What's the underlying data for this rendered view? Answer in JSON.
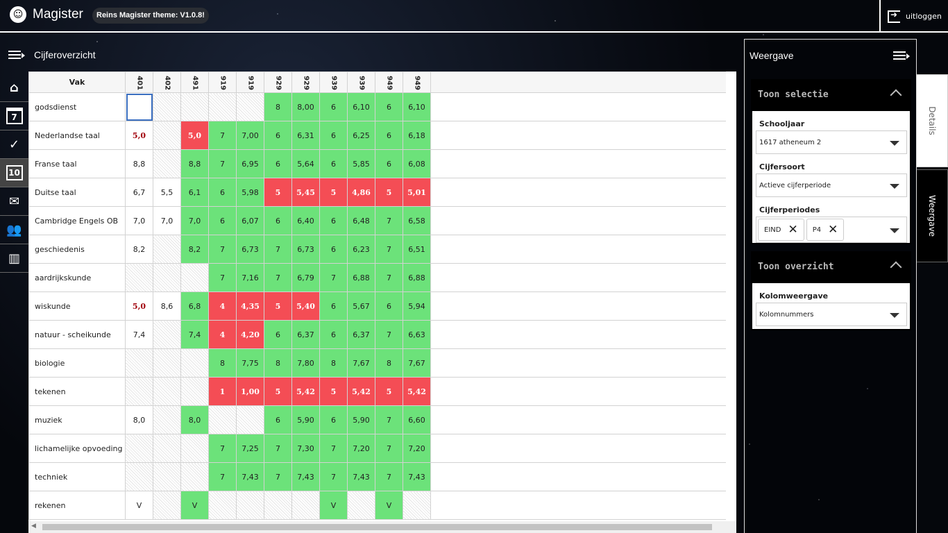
{
  "app": {
    "brand": "Magister",
    "logo_glyph": "☺",
    "theme_badge": "Reins Magister theme: V1.0.8!",
    "logout_label": "uitloggen"
  },
  "page": {
    "title": "Cijferoverzicht"
  },
  "nav": [
    {
      "name": "home-icon",
      "glyph": "⌂"
    },
    {
      "name": "calendar-icon",
      "glyph": "7"
    },
    {
      "name": "check-icon",
      "glyph": "✓"
    },
    {
      "name": "grades-icon",
      "glyph": "10",
      "active": true
    },
    {
      "name": "mail-icon",
      "glyph": "✉"
    },
    {
      "name": "people-icon",
      "glyph": "👥"
    },
    {
      "name": "books-icon",
      "glyph": "▥"
    }
  ],
  "table": {
    "vak_header": "Vak",
    "columns": [
      "401",
      "402",
      "491",
      "919",
      "919",
      "929",
      "929",
      "939",
      "939",
      "949",
      "949"
    ],
    "rows": [
      {
        "subject": "godsdienst",
        "cells": [
          {
            "v": "",
            "c": "sel"
          },
          {
            "v": "",
            "c": "hatch"
          },
          {
            "v": "",
            "c": "hatch"
          },
          {
            "v": "",
            "c": "hatch"
          },
          {
            "v": "",
            "c": "hatch"
          },
          {
            "v": "8",
            "c": "green"
          },
          {
            "v": "8,00",
            "c": "green"
          },
          {
            "v": "6",
            "c": "green"
          },
          {
            "v": "6,10",
            "c": "green"
          },
          {
            "v": "6",
            "c": "green"
          },
          {
            "v": "6,10",
            "c": "green"
          }
        ]
      },
      {
        "subject": "Nederlandse taal",
        "cells": [
          {
            "v": "5,0",
            "c": "low"
          },
          {
            "v": "",
            "c": "hatch"
          },
          {
            "v": "5,0",
            "c": "red"
          },
          {
            "v": "7",
            "c": "green"
          },
          {
            "v": "7,00",
            "c": "green"
          },
          {
            "v": "6",
            "c": "green"
          },
          {
            "v": "6,31",
            "c": "green"
          },
          {
            "v": "6",
            "c": "green"
          },
          {
            "v": "6,25",
            "c": "green"
          },
          {
            "v": "6",
            "c": "green"
          },
          {
            "v": "6,18",
            "c": "green"
          }
        ]
      },
      {
        "subject": "Franse taal",
        "cells": [
          {
            "v": "8,8",
            "c": ""
          },
          {
            "v": "",
            "c": "hatch"
          },
          {
            "v": "8,8",
            "c": "green"
          },
          {
            "v": "7",
            "c": "green"
          },
          {
            "v": "6,95",
            "c": "green"
          },
          {
            "v": "6",
            "c": "green"
          },
          {
            "v": "5,64",
            "c": "green"
          },
          {
            "v": "6",
            "c": "green"
          },
          {
            "v": "5,85",
            "c": "green"
          },
          {
            "v": "6",
            "c": "green"
          },
          {
            "v": "6,08",
            "c": "green"
          }
        ]
      },
      {
        "subject": "Duitse taal",
        "cells": [
          {
            "v": "6,7",
            "c": ""
          },
          {
            "v": "5,5",
            "c": ""
          },
          {
            "v": "6,1",
            "c": "green"
          },
          {
            "v": "6",
            "c": "green"
          },
          {
            "v": "5,98",
            "c": "green"
          },
          {
            "v": "5",
            "c": "red"
          },
          {
            "v": "5,45",
            "c": "red"
          },
          {
            "v": "5",
            "c": "red"
          },
          {
            "v": "4,86",
            "c": "red"
          },
          {
            "v": "5",
            "c": "red"
          },
          {
            "v": "5,01",
            "c": "red"
          }
        ]
      },
      {
        "subject": "Cambridge Engels OB",
        "cells": [
          {
            "v": "7,0",
            "c": ""
          },
          {
            "v": "7,0",
            "c": ""
          },
          {
            "v": "7,0",
            "c": "green"
          },
          {
            "v": "6",
            "c": "green"
          },
          {
            "v": "6,07",
            "c": "green"
          },
          {
            "v": "6",
            "c": "green"
          },
          {
            "v": "6,40",
            "c": "green"
          },
          {
            "v": "6",
            "c": "green"
          },
          {
            "v": "6,48",
            "c": "green"
          },
          {
            "v": "7",
            "c": "green"
          },
          {
            "v": "6,58",
            "c": "green"
          }
        ]
      },
      {
        "subject": "geschiedenis",
        "cells": [
          {
            "v": "8,2",
            "c": ""
          },
          {
            "v": "",
            "c": "hatch"
          },
          {
            "v": "8,2",
            "c": "green"
          },
          {
            "v": "7",
            "c": "green"
          },
          {
            "v": "6,73",
            "c": "green"
          },
          {
            "v": "7",
            "c": "green"
          },
          {
            "v": "6,73",
            "c": "green"
          },
          {
            "v": "6",
            "c": "green"
          },
          {
            "v": "6,23",
            "c": "green"
          },
          {
            "v": "7",
            "c": "green"
          },
          {
            "v": "6,51",
            "c": "green"
          }
        ]
      },
      {
        "subject": "aardrijkskunde",
        "cells": [
          {
            "v": "",
            "c": "hatch"
          },
          {
            "v": "",
            "c": "hatch"
          },
          {
            "v": "",
            "c": "hatch"
          },
          {
            "v": "7",
            "c": "green"
          },
          {
            "v": "7,16",
            "c": "green"
          },
          {
            "v": "7",
            "c": "green"
          },
          {
            "v": "6,79",
            "c": "green"
          },
          {
            "v": "7",
            "c": "green"
          },
          {
            "v": "6,88",
            "c": "green"
          },
          {
            "v": "7",
            "c": "green"
          },
          {
            "v": "6,88",
            "c": "green"
          }
        ]
      },
      {
        "subject": "wiskunde",
        "cells": [
          {
            "v": "5,0",
            "c": "low"
          },
          {
            "v": "8,6",
            "c": ""
          },
          {
            "v": "6,8",
            "c": "green"
          },
          {
            "v": "4",
            "c": "red"
          },
          {
            "v": "4,35",
            "c": "red"
          },
          {
            "v": "5",
            "c": "red"
          },
          {
            "v": "5,40",
            "c": "red"
          },
          {
            "v": "6",
            "c": "green"
          },
          {
            "v": "5,67",
            "c": "green"
          },
          {
            "v": "6",
            "c": "green"
          },
          {
            "v": "5,94",
            "c": "green"
          }
        ]
      },
      {
        "subject": "natuur - scheikunde",
        "cells": [
          {
            "v": "7,4",
            "c": ""
          },
          {
            "v": "",
            "c": "hatch"
          },
          {
            "v": "7,4",
            "c": "green"
          },
          {
            "v": "4",
            "c": "red"
          },
          {
            "v": "4,20",
            "c": "red"
          },
          {
            "v": "6",
            "c": "green"
          },
          {
            "v": "6,37",
            "c": "green"
          },
          {
            "v": "6",
            "c": "green"
          },
          {
            "v": "6,37",
            "c": "green"
          },
          {
            "v": "7",
            "c": "green"
          },
          {
            "v": "6,63",
            "c": "green"
          }
        ]
      },
      {
        "subject": "biologie",
        "cells": [
          {
            "v": "",
            "c": "hatch"
          },
          {
            "v": "",
            "c": "hatch"
          },
          {
            "v": "",
            "c": "hatch"
          },
          {
            "v": "8",
            "c": "green"
          },
          {
            "v": "7,75",
            "c": "green"
          },
          {
            "v": "8",
            "c": "green"
          },
          {
            "v": "7,80",
            "c": "green"
          },
          {
            "v": "8",
            "c": "green"
          },
          {
            "v": "7,67",
            "c": "green"
          },
          {
            "v": "8",
            "c": "green"
          },
          {
            "v": "7,67",
            "c": "green"
          }
        ]
      },
      {
        "subject": "tekenen",
        "cells": [
          {
            "v": "",
            "c": "hatch"
          },
          {
            "v": "",
            "c": "hatch"
          },
          {
            "v": "",
            "c": "hatch"
          },
          {
            "v": "1",
            "c": "red"
          },
          {
            "v": "1,00",
            "c": "red"
          },
          {
            "v": "5",
            "c": "red"
          },
          {
            "v": "5,42",
            "c": "red"
          },
          {
            "v": "5",
            "c": "red"
          },
          {
            "v": "5,42",
            "c": "red"
          },
          {
            "v": "5",
            "c": "red"
          },
          {
            "v": "5,42",
            "c": "red"
          }
        ]
      },
      {
        "subject": "muziek",
        "cells": [
          {
            "v": "8,0",
            "c": ""
          },
          {
            "v": "",
            "c": "hatch"
          },
          {
            "v": "8,0",
            "c": "green"
          },
          {
            "v": "",
            "c": "hatch"
          },
          {
            "v": "",
            "c": "hatch"
          },
          {
            "v": "6",
            "c": "green"
          },
          {
            "v": "5,90",
            "c": "green"
          },
          {
            "v": "6",
            "c": "green"
          },
          {
            "v": "5,90",
            "c": "green"
          },
          {
            "v": "7",
            "c": "green"
          },
          {
            "v": "6,60",
            "c": "green"
          }
        ]
      },
      {
        "subject": "lichamelijke opvoeding",
        "cells": [
          {
            "v": "",
            "c": "hatch"
          },
          {
            "v": "",
            "c": "hatch"
          },
          {
            "v": "",
            "c": "hatch"
          },
          {
            "v": "7",
            "c": "green"
          },
          {
            "v": "7,25",
            "c": "green"
          },
          {
            "v": "7",
            "c": "green"
          },
          {
            "v": "7,30",
            "c": "green"
          },
          {
            "v": "7",
            "c": "green"
          },
          {
            "v": "7,20",
            "c": "green"
          },
          {
            "v": "7",
            "c": "green"
          },
          {
            "v": "7,20",
            "c": "green"
          }
        ]
      },
      {
        "subject": "techniek",
        "cells": [
          {
            "v": "",
            "c": "hatch"
          },
          {
            "v": "",
            "c": "hatch"
          },
          {
            "v": "",
            "c": "hatch"
          },
          {
            "v": "7",
            "c": "green"
          },
          {
            "v": "7,43",
            "c": "green"
          },
          {
            "v": "7",
            "c": "green"
          },
          {
            "v": "7,43",
            "c": "green"
          },
          {
            "v": "7",
            "c": "green"
          },
          {
            "v": "7,43",
            "c": "green"
          },
          {
            "v": "7",
            "c": "green"
          },
          {
            "v": "7,43",
            "c": "green"
          }
        ]
      },
      {
        "subject": "rekenen",
        "cells": [
          {
            "v": "V",
            "c": ""
          },
          {
            "v": "",
            "c": "hatch"
          },
          {
            "v": "V",
            "c": "green"
          },
          {
            "v": "",
            "c": "hatch"
          },
          {
            "v": "",
            "c": "hatch"
          },
          {
            "v": "",
            "c": "hatch"
          },
          {
            "v": "",
            "c": "hatch"
          },
          {
            "v": "V",
            "c": "green"
          },
          {
            "v": "",
            "c": "hatch"
          },
          {
            "v": "V",
            "c": "green"
          },
          {
            "v": "",
            "c": "hatch"
          }
        ]
      }
    ]
  },
  "colors": {
    "pass": "#6ce27a",
    "fail": "#f44d55",
    "fail_text": "#a1000b"
  },
  "panel": {
    "title": "Weergave",
    "selectie": {
      "heading": "Toon selectie",
      "schooljaar_label": "Schooljaar",
      "schooljaar_value": "1617 atheneum 2",
      "cijfersoort_label": "Cijfersoort",
      "cijfersoort_value": "Actieve cijferperiode",
      "cijferperiodes_label": "Cijferperiodes",
      "chips": [
        "EIND",
        "P4"
      ]
    },
    "overzicht": {
      "heading": "Toon overzicht",
      "kolom_label": "Kolomweergave",
      "kolom_value": "Kolomnummers"
    }
  },
  "tabs": {
    "details": "Details",
    "weergave": "Weergave"
  }
}
